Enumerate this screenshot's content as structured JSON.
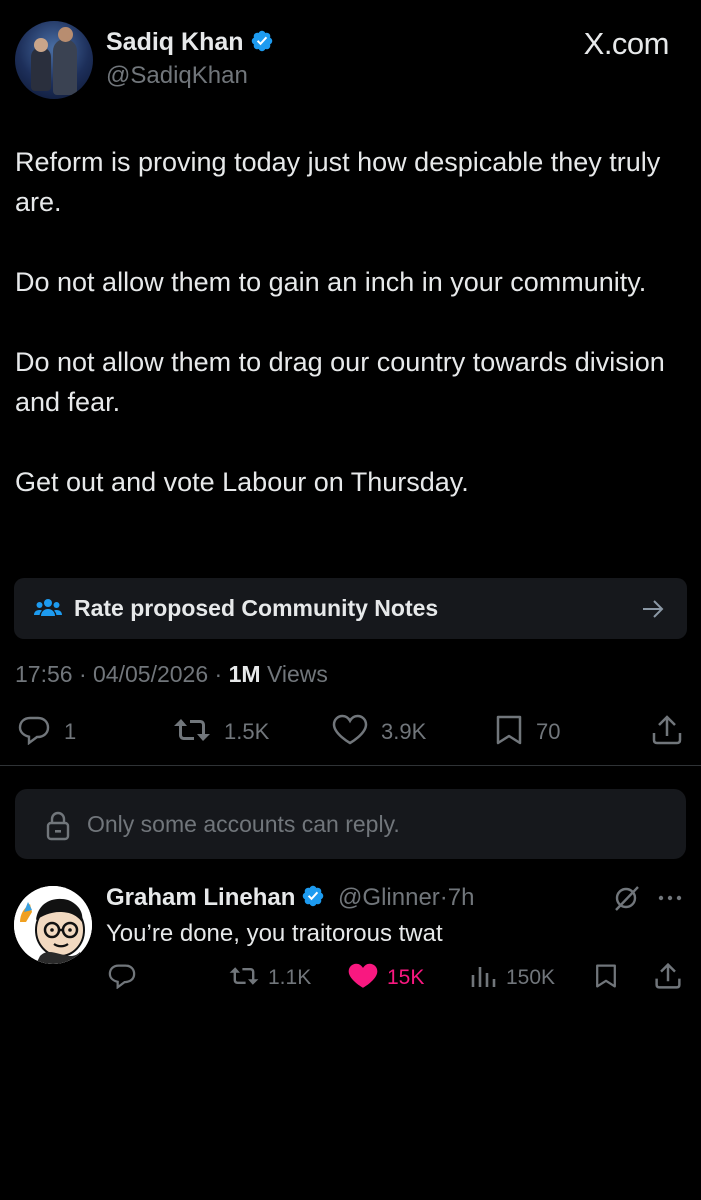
{
  "tweet": {
    "author_name": "Sadiq Khan",
    "author_handle": "@SadiqKhan",
    "site_label": "X.com",
    "paragraphs": [
      "Reform is proving today just how despicable they truly are.",
      "Do not allow them to gain an inch in your community.",
      "Do not allow them to drag our country towards division and fear.",
      "Get out and vote Labour on Thursday."
    ],
    "community_notes_label": "Rate proposed Community Notes",
    "time": "17:56",
    "date": "04/05/2026",
    "views_count": "1M",
    "views_label": "Views",
    "actions": {
      "replies": "1",
      "reposts": "1.5K",
      "likes": "3.9K",
      "bookmarks": "70"
    }
  },
  "reply_restriction": "Only some accounts can reply.",
  "reply": {
    "author_name": "Graham Linehan",
    "author_handle": "@Glinner",
    "age": "7h",
    "text": "You’re done, you traitorous twat",
    "actions": {
      "replies": "",
      "reposts": "1.1K",
      "likes": "15K",
      "views": "150K"
    }
  },
  "colors": {
    "background": "#000000",
    "text": "#e7e9ea",
    "muted": "#71767b",
    "verified": "#1d9bf0",
    "like_active": "#f91880",
    "card": "#16181c"
  }
}
